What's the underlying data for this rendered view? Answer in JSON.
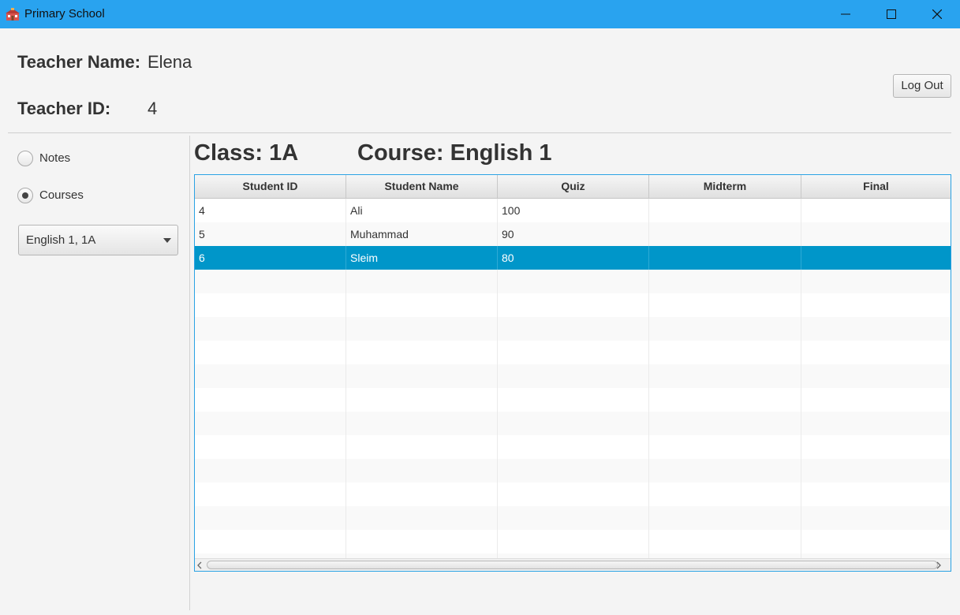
{
  "window": {
    "title": "Primary School",
    "icon": "school-icon",
    "controls": [
      "minimize-icon",
      "maximize-icon",
      "close-icon"
    ]
  },
  "header": {
    "teacher_name_label": "Teacher Name:",
    "teacher_name_value": "Elena",
    "teacher_id_label": "Teacher ID:",
    "teacher_id_value": "4",
    "logout_label": "Log Out"
  },
  "sidebar": {
    "options": [
      {
        "label": "Notes",
        "selected": false
      },
      {
        "label": "Courses",
        "selected": true
      }
    ],
    "course_select": {
      "value": "English 1, 1A",
      "icon": "chevron-down-icon"
    }
  },
  "main": {
    "class_heading": "Class: 1A",
    "course_heading": "Course: English 1"
  },
  "table": {
    "columns": [
      "Student ID",
      "Student Name",
      "Quiz",
      "Midterm",
      "Final"
    ],
    "rows": [
      [
        "4",
        "Ali",
        "100",
        "",
        ""
      ],
      [
        "5",
        "Muhammad",
        "90",
        "",
        ""
      ],
      [
        "6",
        "Sleim",
        "80",
        "",
        ""
      ]
    ],
    "selected_row": 2
  },
  "colors": {
    "titlebar": "#29a3ef",
    "selection": "#0096c9",
    "table_border": "#2aa2e4"
  }
}
